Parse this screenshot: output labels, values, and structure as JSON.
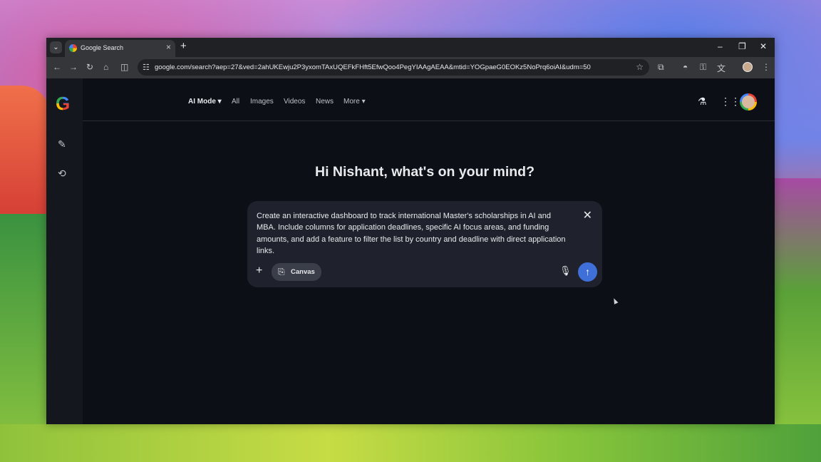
{
  "browser": {
    "tab_title": "Google Search",
    "url": "google.com/search?aep=27&ved=2ahUKEwju2P3yxomTAxUQEFkFHft5EfwQoo4PegYIAAgAEAA&mtid=YOGpaeG0EOKz5NoPrq6oiAI&udm=50"
  },
  "nav": {
    "ai_mode": "AI Mode",
    "all": "All",
    "images": "Images",
    "videos": "Videos",
    "news": "News",
    "more": "More"
  },
  "main": {
    "greeting": "Hi Nishant, what's on your mind?",
    "prompt_text": "Create an interactive dashboard to track international Master's scholarships in AI and MBA. Include columns for application deadlines, specific AI focus areas, and funding amounts, and add a feature to filter the list by country and deadline with direct application links.",
    "canvas_label": "Canvas"
  },
  "colors": {
    "send_button": "#3f6fd8",
    "page_background": "#0d0f17"
  },
  "icons": {
    "tab_favicon": "google-icon",
    "rail": [
      "edit-icon",
      "history-icon"
    ],
    "header": [
      "labs-flask-icon",
      "apps-grid-icon",
      "account-avatar"
    ]
  }
}
